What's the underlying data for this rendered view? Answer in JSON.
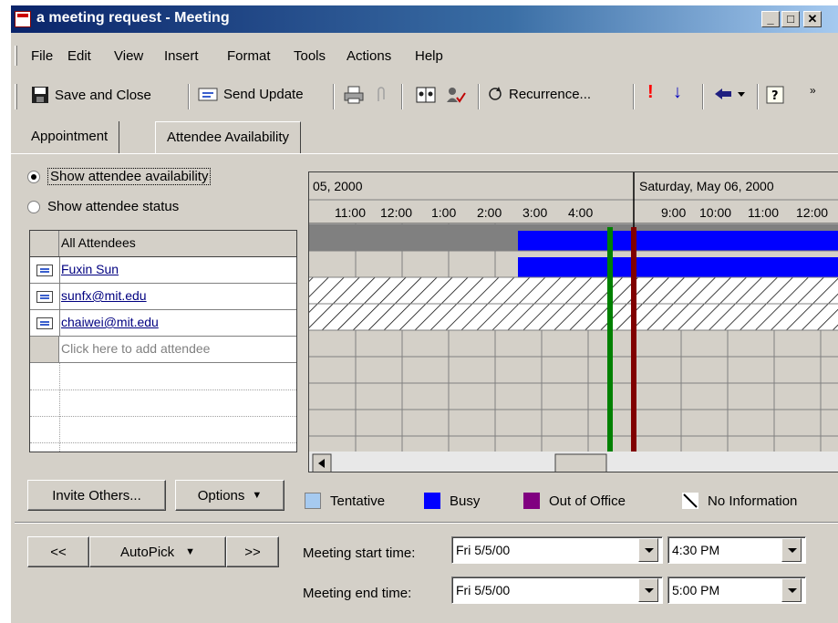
{
  "window": {
    "title": "a meeting request - Meeting"
  },
  "menu": [
    "File",
    "Edit",
    "View",
    "Insert",
    "Format",
    "Tools",
    "Actions",
    "Help"
  ],
  "toolbar": {
    "save_close": "Save and Close",
    "send_update": "Send Update",
    "recurrence": "Recurrence..."
  },
  "tabs": [
    {
      "label": "Appointment"
    },
    {
      "label": "Attendee Availability"
    }
  ],
  "options": {
    "show_availability": "Show attendee availability",
    "show_status": "Show attendee status"
  },
  "attendees": {
    "header": "All Attendees",
    "rows": [
      "Fuxin Sun",
      "sunfx@mit.edu",
      "chaiwei@mit.edu"
    ],
    "add_placeholder": "Click here to add attendee"
  },
  "timeline": {
    "day1": "05, 2000",
    "day2": "Saturday, May 06, 2000",
    "hours1": [
      "11:00",
      "12:00",
      "1:00",
      "2:00",
      "3:00",
      "4:00"
    ],
    "hours2": [
      "9:00",
      "10:00",
      "11:00",
      "12:00"
    ]
  },
  "legend": {
    "tentative": "Tentative",
    "busy": "Busy",
    "out_of_office": "Out of Office",
    "no_info": "No Information"
  },
  "colors": {
    "tentative": "#a6caf0",
    "busy": "#0000ff",
    "out_of_office": "#800080",
    "start_line": "#008000",
    "end_line": "#800000"
  },
  "buttons": {
    "invite": "Invite Others...",
    "options": "Options",
    "prev": "<<",
    "autopick": "AutoPick",
    "next": ">>"
  },
  "meeting": {
    "start_label": "Meeting start time:",
    "start_date": "Fri 5/5/00",
    "start_time": "4:30 PM",
    "end_label": "Meeting end time:",
    "end_date": "Fri 5/5/00",
    "end_time": "5:00 PM"
  }
}
